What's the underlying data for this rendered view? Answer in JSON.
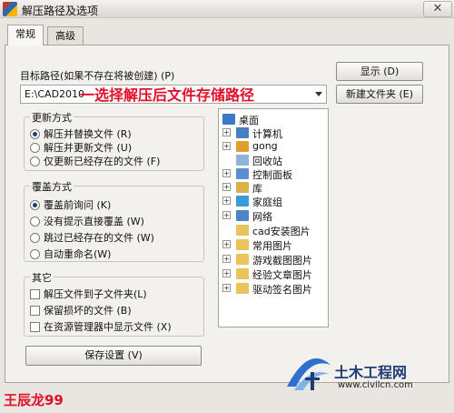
{
  "window": {
    "title": "解压路径及选项",
    "close_label": "✕"
  },
  "tabs": [
    {
      "label": "常规"
    },
    {
      "label": "高级"
    }
  ],
  "target": {
    "label": "目标路径(如果不存在将被创建) (P)",
    "value": "E:\\CAD2010",
    "annotation": "一选择解压后文件存储路径"
  },
  "buttons": {
    "show": "显示 (D)",
    "new_folder": "新建文件夹 (E)",
    "save": "保存设置 (V)"
  },
  "update_mode": {
    "title": "更新方式",
    "options": [
      "解压并替换文件 (R)",
      "解压并更新文件 (U)",
      "仅更新已经存在的文件 (F)"
    ],
    "selected": 0
  },
  "overwrite_mode": {
    "title": "覆盖方式",
    "options": [
      "覆盖前询问 (K)",
      "没有提示直接覆盖 (W)",
      "跳过已经存在的文件 (W)",
      "自动重命名(W)"
    ],
    "selected": 0
  },
  "misc": {
    "title": "其它",
    "options": [
      "解压文件到子文件夹(L)",
      "保留损坏的文件 (B)",
      "在资源管理器中显示文件 (X)"
    ]
  },
  "tree": {
    "items": [
      {
        "label": "桌面",
        "icon": "desktop-icon",
        "color": "#3d78c8"
      },
      {
        "label": "计算机",
        "icon": "computer-icon",
        "color": "#4a7fbf"
      },
      {
        "label": "gong",
        "icon": "user-icon",
        "color": "#e0a030"
      },
      {
        "label": "回收站",
        "icon": "recycle-bin-icon",
        "color": "#8fb3d8"
      },
      {
        "label": "控制面板",
        "icon": "control-panel-icon",
        "color": "#5b8fd0"
      },
      {
        "label": "库",
        "icon": "library-icon",
        "color": "#d9b24a"
      },
      {
        "label": "家庭组",
        "icon": "homegroup-icon",
        "color": "#3b9bd8"
      },
      {
        "label": "网络",
        "icon": "network-icon",
        "color": "#4d86c7"
      },
      {
        "label": "cad安装图片",
        "icon": "folder-icon",
        "color": "#e8c45a"
      },
      {
        "label": "常用图片",
        "icon": "folder-icon",
        "color": "#e8c45a"
      },
      {
        "label": "游戏截图图片",
        "icon": "folder-icon",
        "color": "#e8c45a"
      },
      {
        "label": "经验文章图片",
        "icon": "folder-icon",
        "color": "#e8c45a"
      },
      {
        "label": "驱动签名图片",
        "icon": "folder-icon",
        "color": "#e8c45a"
      }
    ]
  },
  "watermark": {
    "name": "王辰龙99",
    "site_name": "土木工程网",
    "site_url": "www.civilcn.com"
  },
  "colors": {
    "accent_red": "#e0102a",
    "brand_blue": "#1e3e74"
  }
}
